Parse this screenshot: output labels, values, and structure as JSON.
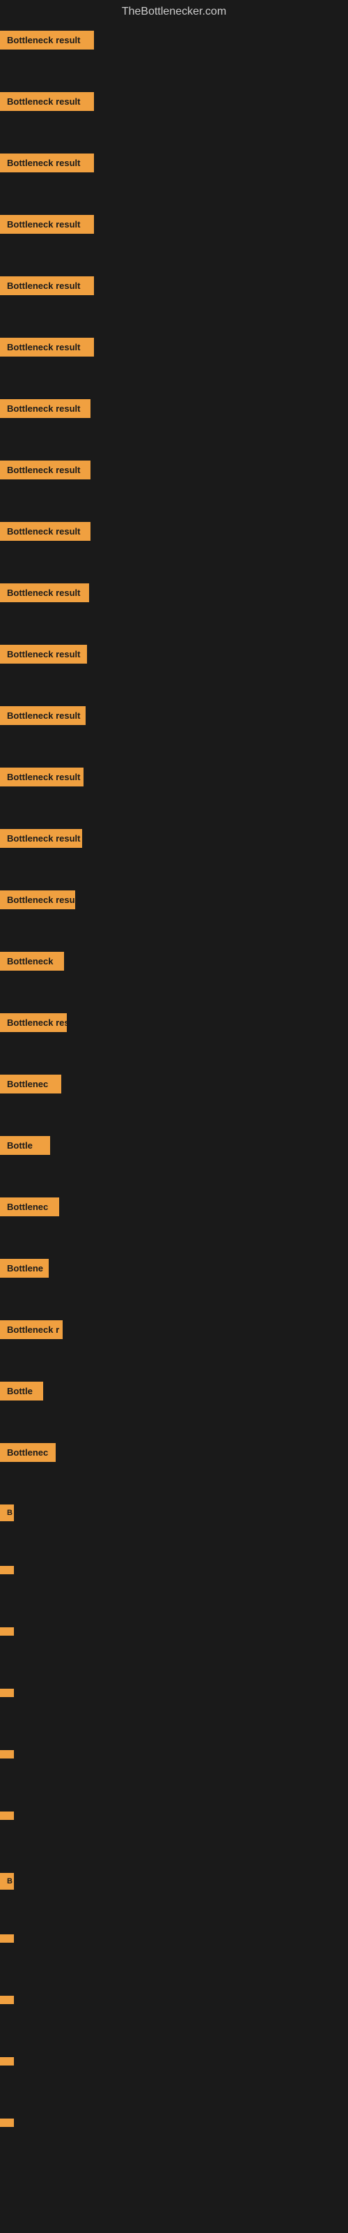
{
  "site": {
    "title": "TheBottlenecker.com"
  },
  "items": [
    {
      "id": 1,
      "label": "Bottleneck result"
    },
    {
      "id": 2,
      "label": "Bottleneck result"
    },
    {
      "id": 3,
      "label": "Bottleneck result"
    },
    {
      "id": 4,
      "label": "Bottleneck result"
    },
    {
      "id": 5,
      "label": "Bottleneck result"
    },
    {
      "id": 6,
      "label": "Bottleneck result"
    },
    {
      "id": 7,
      "label": "Bottleneck result"
    },
    {
      "id": 8,
      "label": "Bottleneck result"
    },
    {
      "id": 9,
      "label": "Bottleneck result"
    },
    {
      "id": 10,
      "label": "Bottleneck result"
    },
    {
      "id": 11,
      "label": "Bottleneck result"
    },
    {
      "id": 12,
      "label": "Bottleneck result"
    },
    {
      "id": 13,
      "label": "Bottleneck result"
    },
    {
      "id": 14,
      "label": "Bottleneck result"
    },
    {
      "id": 15,
      "label": "Bottleneck resu"
    },
    {
      "id": 16,
      "label": "Bottleneck"
    },
    {
      "id": 17,
      "label": "Bottleneck res"
    },
    {
      "id": 18,
      "label": "Bottlenec"
    },
    {
      "id": 19,
      "label": "Bottle"
    },
    {
      "id": 20,
      "label": "Bottlenec"
    },
    {
      "id": 21,
      "label": "Bottlene"
    },
    {
      "id": 22,
      "label": "Bottleneck r"
    },
    {
      "id": 23,
      "label": "Bottle"
    },
    {
      "id": 24,
      "label": "Bottlenec"
    },
    {
      "id": 25,
      "label": "B"
    },
    {
      "id": 26,
      "label": ""
    },
    {
      "id": 27,
      "label": ""
    },
    {
      "id": 28,
      "label": ""
    },
    {
      "id": 29,
      "label": ""
    },
    {
      "id": 30,
      "label": ""
    },
    {
      "id": 31,
      "label": "B"
    },
    {
      "id": 32,
      "label": ""
    },
    {
      "id": 33,
      "label": ""
    },
    {
      "id": 34,
      "label": ""
    },
    {
      "id": 35,
      "label": ""
    }
  ]
}
